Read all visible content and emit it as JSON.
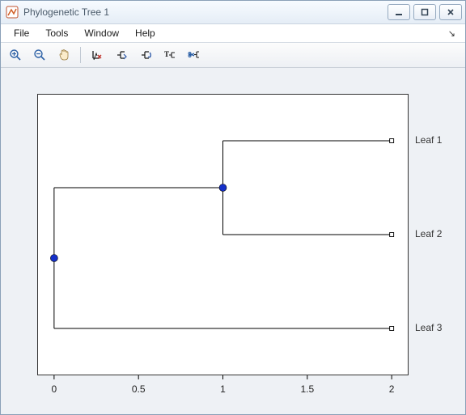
{
  "window": {
    "title": "Phylogenetic Tree 1"
  },
  "menu": {
    "file": "File",
    "tools": "Tools",
    "window_menu": "Window",
    "help": "Help"
  },
  "toolbar_icons": {
    "zoom_in": "zoom-in-icon",
    "zoom_out": "zoom-out-icon",
    "pan": "pan-icon",
    "inspect": "inspect-tool-icon",
    "collapse": "collapse-expand-icon",
    "rotate": "rotate-branch-icon",
    "rename": "rename-leaf-icon",
    "prune": "prune-icon"
  },
  "chart_data": {
    "type": "dendrogram",
    "xlim": [
      -0.1,
      2.1
    ],
    "xticks": [
      0,
      0.5,
      1,
      1.5,
      2
    ],
    "xticklabels": [
      "0",
      "0.5",
      "1",
      "1.5",
      "2"
    ],
    "leaves": [
      {
        "label": "Leaf 1",
        "x": 2.0,
        "y": 1
      },
      {
        "label": "Leaf 2",
        "x": 2.0,
        "y": 2
      },
      {
        "label": "Leaf 3",
        "x": 2.0,
        "y": 3
      }
    ],
    "internal_nodes": [
      {
        "name": "node12",
        "x": 1.0,
        "y": 1.5,
        "children": [
          "Leaf 1",
          "Leaf 2"
        ]
      },
      {
        "name": "root",
        "x": 0.0,
        "y": 2.25,
        "children": [
          "node12",
          "Leaf 3"
        ]
      }
    ],
    "branches": [
      {
        "from": "node12",
        "to": "Leaf 1"
      },
      {
        "from": "node12",
        "to": "Leaf 2"
      },
      {
        "from": "root",
        "to": "node12"
      },
      {
        "from": "root",
        "to": "Leaf 3"
      }
    ]
  }
}
